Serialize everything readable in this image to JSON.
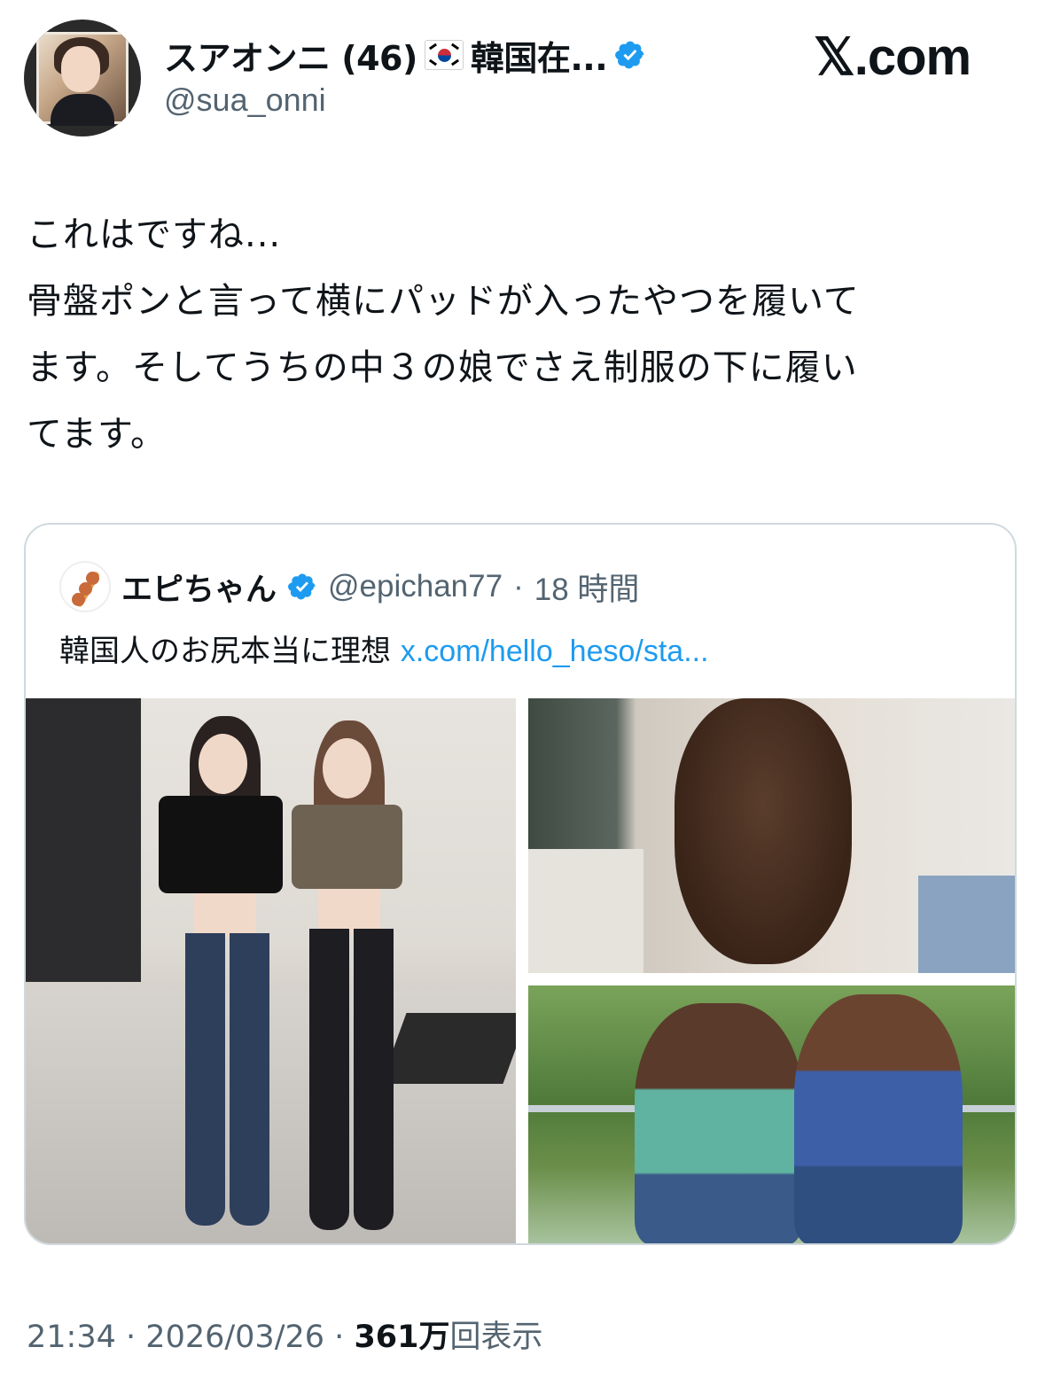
{
  "author": {
    "display_name": "スアオンニ (46)",
    "name_suffix": "韓国在...",
    "handle": "@sua_onni",
    "flag_icon": "south-korea-flag-icon",
    "verified_icon": "verified-badge-icon"
  },
  "site_logo": "𝕏.com",
  "tweet": {
    "lines": [
      "これはですね...",
      "骨盤ポンと言って横にパッドが入ったやつを履いて",
      "ます。そしてうちの中３の娘でさえ制服の下に履い",
      "てます。"
    ]
  },
  "quote": {
    "display_name": "エピちゃん",
    "handle": "@epichan77",
    "separator": "·",
    "time": "18 時間",
    "text": "韓国人のお尻本当に理想",
    "link": "x.com/hello_heso/sta..."
  },
  "footer": {
    "time": "21:34",
    "sep1": "·",
    "date": "2026/03/26",
    "sep2": "·",
    "views_count": "361万",
    "views_label": "回表示"
  },
  "colors": {
    "text": "#0f1419",
    "secondary": "#536471",
    "link": "#1d9bf0",
    "verified": "#1d9bf0",
    "border": "#cfd9de"
  }
}
